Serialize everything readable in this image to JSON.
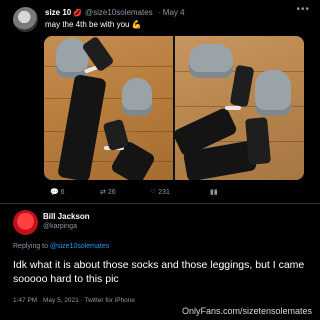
{
  "tweet1": {
    "display_name": "size 10",
    "handle": "@size10solemates",
    "date": "· May 4",
    "more_icon": "more-dots-icon",
    "text": "may the 4th be with you",
    "text_emoji": "💪",
    "actions": {
      "reply_count": "6",
      "retweet_count": "26",
      "like_count": "231"
    }
  },
  "tweet2": {
    "display_name": "Bill Jackson",
    "handle": "@karpinga",
    "replying_prefix": "Replying to",
    "replying_to": "@size10solemates",
    "text": "Idk what it is about those socks and those leggings, but I came sooooo hard to this pic",
    "timestamp": "1:47 PM · May 5, 2021 · Twitter for iPhone"
  },
  "watermark": "OnlyFans.com/sizetensolemates",
  "colors": {
    "background": "#000000",
    "link": "#1d9bf0",
    "muted": "#8b98a5"
  }
}
